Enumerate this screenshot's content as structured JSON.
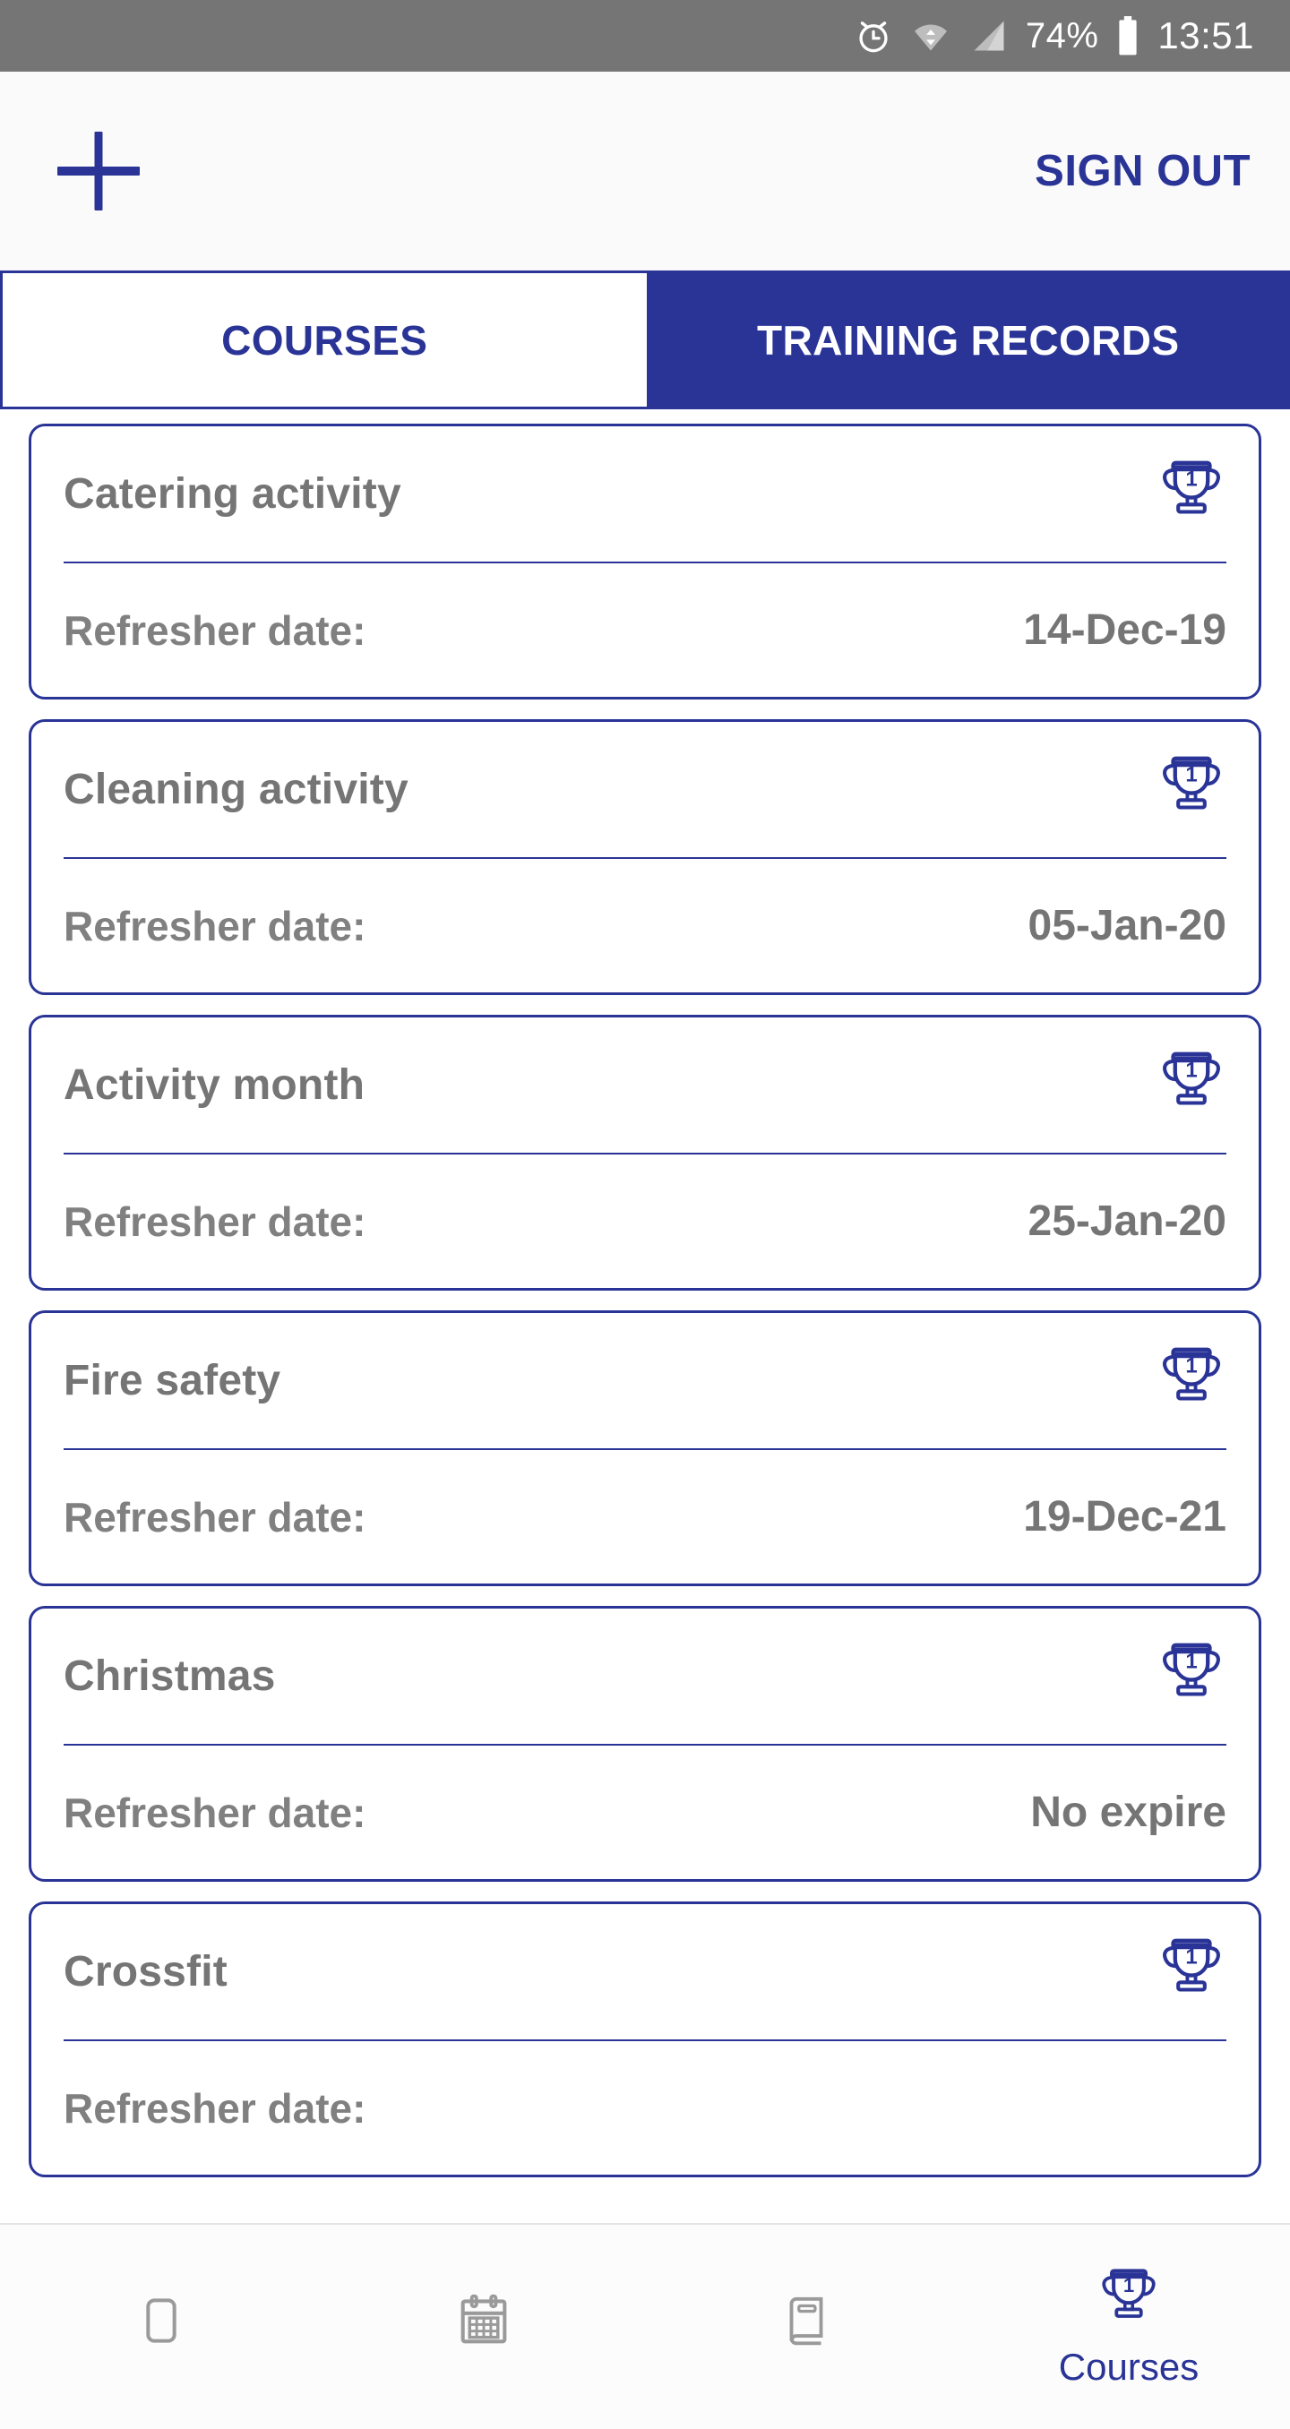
{
  "statusbar": {
    "alarm_icon": "alarm-clock-icon",
    "wifi_icon": "wifi-icon",
    "signal_icon": "signal-icon",
    "battery_percent": "74%",
    "battery_icon": "battery-icon",
    "time": "13:51"
  },
  "appbar": {
    "add_icon": "plus-icon",
    "signout_label": "SIGN OUT"
  },
  "tabs": [
    {
      "label": "COURSES",
      "active": true
    },
    {
      "label": "TRAINING RECORDS",
      "active": false
    }
  ],
  "list": {
    "refresher_label": "Refresher date:",
    "trophy_icon": "trophy-1-icon",
    "cards": [
      {
        "title": "Catering activity",
        "date": "14-Dec-19"
      },
      {
        "title": "Cleaning activity",
        "date": "05-Jan-20"
      },
      {
        "title": "Activity month",
        "date": "25-Jan-20"
      },
      {
        "title": "Fire safety",
        "date": "19-Dec-21"
      },
      {
        "title": "Christmas",
        "date": "No expire"
      },
      {
        "title": "Crossfit",
        "date": ""
      }
    ]
  },
  "bottomnav": {
    "items": [
      {
        "icon": "rounded-square-icon",
        "label": "",
        "active": false
      },
      {
        "icon": "calendar-icon",
        "label": "",
        "active": false
      },
      {
        "icon": "book-icon",
        "label": "",
        "active": false
      },
      {
        "icon": "trophy-1-icon",
        "label": "Courses",
        "active": true
      }
    ]
  },
  "colors": {
    "brand_blue": "#2a3496",
    "text_gray": "#757575",
    "statusbar_gray": "#757575",
    "nav_icon_gray": "#8c8c8c"
  }
}
